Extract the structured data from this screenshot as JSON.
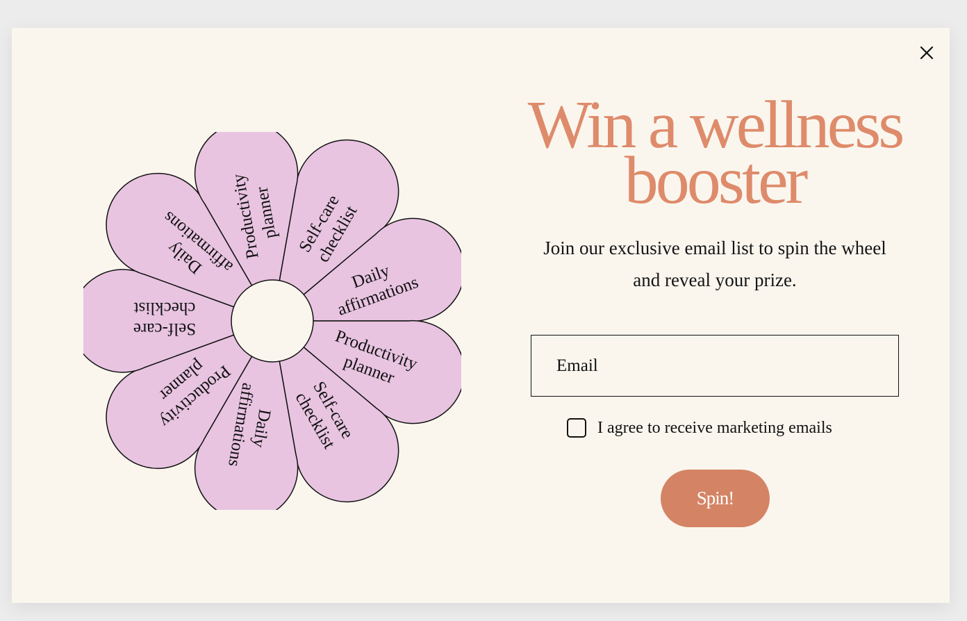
{
  "modal": {
    "title_line1": "Win a wellness",
    "title_line2": "booster",
    "subtitle": "Join our exclusive email list to spin the wheel and reveal your prize.",
    "close_icon": "close-icon"
  },
  "form": {
    "email_placeholder": "Email",
    "email_value": "",
    "consent_label": "I agree to receive marketing emails",
    "consent_checked": false,
    "spin_label": "Spin!"
  },
  "wheel": {
    "segments": [
      {
        "label_line1": "Self-care",
        "label_line2": "checklist"
      },
      {
        "label_line1": "Daily",
        "label_line2": "affirmations"
      },
      {
        "label_line1": "Productivity",
        "label_line2": "planner"
      },
      {
        "label_line1": "Self-care",
        "label_line2": "checklist"
      },
      {
        "label_line1": "Daily",
        "label_line2": "affirmations"
      },
      {
        "label_line1": "Productivity",
        "label_line2": "planner"
      },
      {
        "label_line1": "Self-care",
        "label_line2": "checklist"
      },
      {
        "label_line1": "Daily",
        "label_line2": "affirmations"
      },
      {
        "label_line1": "Productivity",
        "label_line2": "planner"
      }
    ]
  },
  "colors": {
    "background": "#faf6ee",
    "accent": "#de8b6b",
    "button": "#d48464",
    "petal": "#e8c4e1"
  }
}
